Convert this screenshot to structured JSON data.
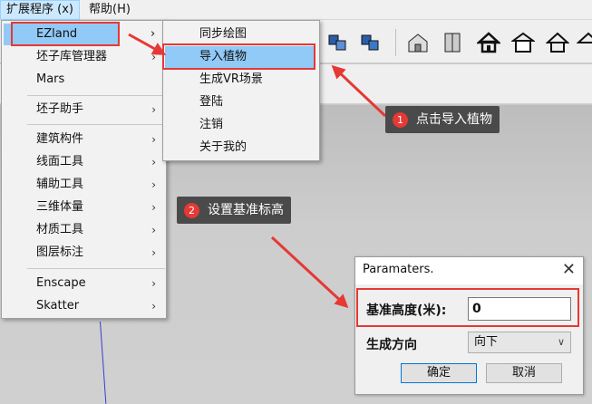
{
  "menubar": {
    "extensions": "扩展程序 (x)",
    "help": "帮助(H)"
  },
  "main_menu": {
    "items": [
      {
        "label": "EZland",
        "submenu": true
      },
      {
        "label": "坯子库管理器",
        "submenu": true
      },
      {
        "label": "Mars",
        "submenu": false
      },
      {
        "label": "坯子助手",
        "submenu": true
      },
      {
        "label": "建筑构件",
        "submenu": true
      },
      {
        "label": "线面工具",
        "submenu": true
      },
      {
        "label": "辅助工具",
        "submenu": true
      },
      {
        "label": "三维体量",
        "submenu": true
      },
      {
        "label": "材质工具",
        "submenu": true
      },
      {
        "label": "图层标注",
        "submenu": true
      },
      {
        "label": "Enscape",
        "submenu": true
      },
      {
        "label": "Skatter",
        "submenu": true
      }
    ],
    "arrow": "›"
  },
  "sub_menu": {
    "items": [
      {
        "label": "同步绘图"
      },
      {
        "label": "导入植物"
      },
      {
        "label": "生成VR场景"
      },
      {
        "label": "登陆"
      },
      {
        "label": "注销"
      },
      {
        "label": "关于我的"
      }
    ]
  },
  "callouts": [
    {
      "num": "1",
      "text": "点击导入植物"
    },
    {
      "num": "2",
      "text": "设置基准标高"
    }
  ],
  "dialog": {
    "title": "Paramaters.",
    "close": "✕",
    "height_label": "基准高度(米):",
    "height_value": "0",
    "direction_label": "生成方向",
    "direction_value": "向下",
    "ok": "确定",
    "cancel": "取消"
  },
  "colors": {
    "highlight": "#e53935",
    "menu_hover": "#91c9f7",
    "callout_bg": "#4a4a4a"
  }
}
